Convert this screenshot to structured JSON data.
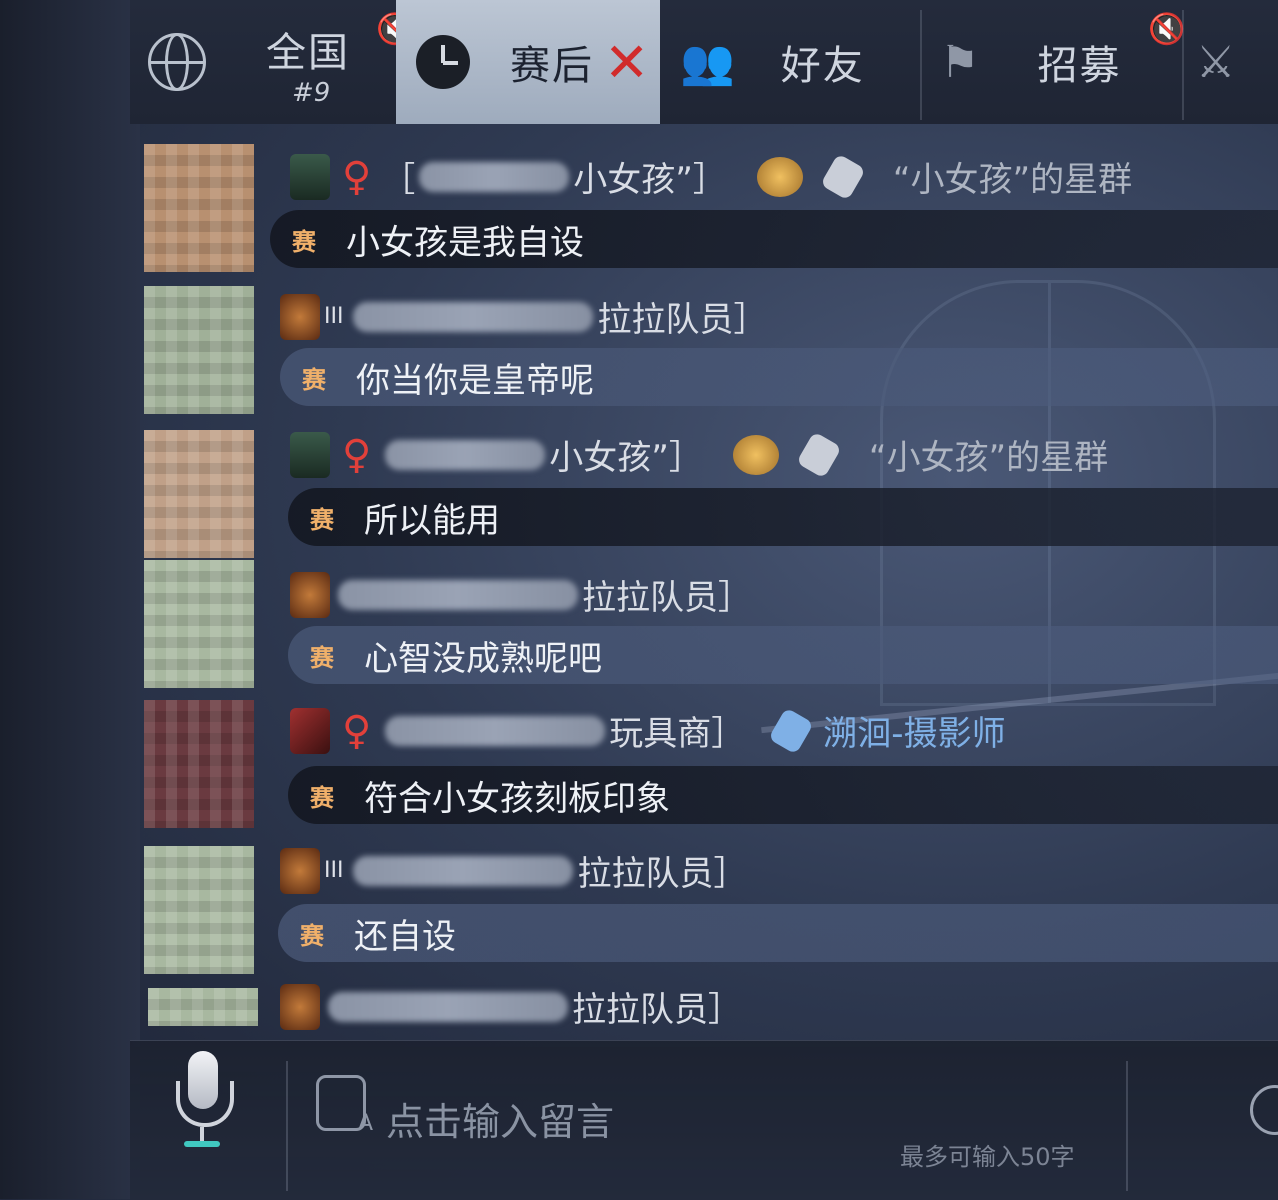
{
  "tabs": [
    {
      "label": "全国",
      "sub": "#9",
      "icon": "globe-icon"
    },
    {
      "label": "赛后",
      "icon": "clock-icon",
      "active": true,
      "close": "✕"
    },
    {
      "label": "好友",
      "icon": "friends-icon"
    },
    {
      "label": "招募",
      "icon": "flags-icon"
    }
  ],
  "messages": [
    {
      "name_suffix": "小女孩”］",
      "group": "“小女孩”的星群",
      "gender": "♀",
      "badge": "赛",
      "text": "小女孩是我自设",
      "style": "dark"
    },
    {
      "name_suffix": "拉拉队员］",
      "badge": "赛",
      "text": "你当你是皇帝呢",
      "style": "light"
    },
    {
      "name_suffix": "小女孩”］",
      "group": "“小女孩”的星群",
      "gender": "♀",
      "badge": "赛",
      "text": "所以能用",
      "style": "dark"
    },
    {
      "name_suffix": "拉拉队员］",
      "badge": "赛",
      "text": "心智没成熟呢吧",
      "style": "light"
    },
    {
      "name_suffix": "玩具商］",
      "group": "溯洄-摄影师",
      "gender": "♀",
      "badge": "赛",
      "text": "符合小女孩刻板印象",
      "style": "dark"
    },
    {
      "name_suffix": "拉拉队员］",
      "badge": "赛",
      "text": "还自设",
      "style": "light"
    },
    {
      "name_suffix": "拉拉队员］"
    }
  ],
  "input": {
    "placeholder": "点击输入留言",
    "limit_hint": "最多可输入50字"
  },
  "colors": {
    "female": "#e2403a",
    "badge": "#f0b06a",
    "close": "#d12b2b"
  }
}
